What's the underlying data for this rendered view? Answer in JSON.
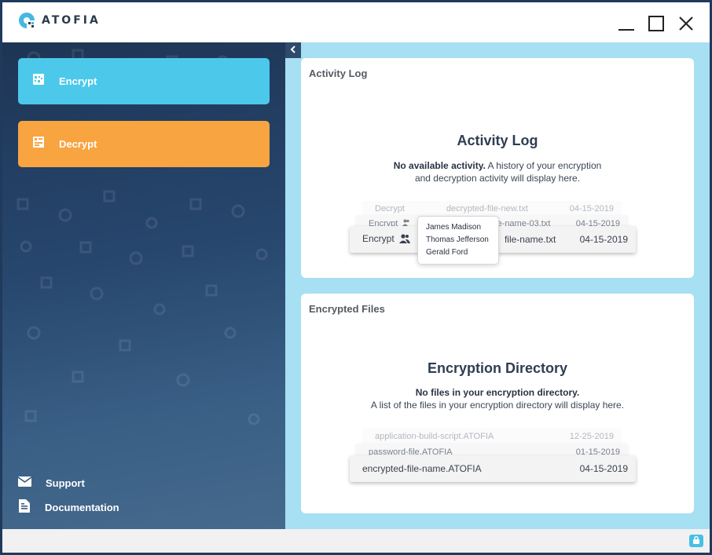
{
  "app": {
    "name": "ATOFIA"
  },
  "sidebar": {
    "encrypt_label": "Encrypt",
    "decrypt_label": "Decrypt",
    "support_label": "Support",
    "documentation_label": "Documentation"
  },
  "activity_card": {
    "header": "Activity Log",
    "title": "Activity Log",
    "message_bold": "No available activity.",
    "message_line1_rest": " A history of your encryption",
    "message_line2": "and decryption activity will display here.",
    "rows": [
      {
        "action": "Decrypt",
        "file": "decrypted-file-new.txt",
        "date": "04-15-2019"
      },
      {
        "action": "Encrypt",
        "file": "file-name-03.txt",
        "date": "04-15-2019"
      },
      {
        "action": "Encrypt",
        "file": "file-name.txt",
        "date": "04-15-2019"
      }
    ],
    "tooltip_users": [
      "James Madison",
      "Thomas Jefferson",
      "Gerald Ford"
    ]
  },
  "files_card": {
    "header": "Encrypted Files",
    "title": "Encryption Directory",
    "message_bold": "No files in your encryption directory.",
    "message_line2": "A list of the files in your encryption directory will display here.",
    "rows": [
      {
        "file": "application-build-script.ATOFIA",
        "date": "12-25-2019"
      },
      {
        "file": "password-file.ATOFIA",
        "date": "01-15-2019"
      },
      {
        "file": "encrypted-file-name.ATOFIA",
        "date": "04-15-2019"
      }
    ]
  },
  "colors": {
    "encrypt": "#4cc8ea",
    "decrypt": "#f8a441",
    "main_bg": "#a6e0f2",
    "sidebar": "#27476e"
  },
  "icons": [
    "atofia-logo-icon",
    "minimize-icon",
    "maximize-icon",
    "close-icon",
    "encrypt-icon",
    "decrypt-icon",
    "mail-icon",
    "document-icon",
    "chevron-left-icon",
    "users-icon",
    "lock-icon"
  ]
}
